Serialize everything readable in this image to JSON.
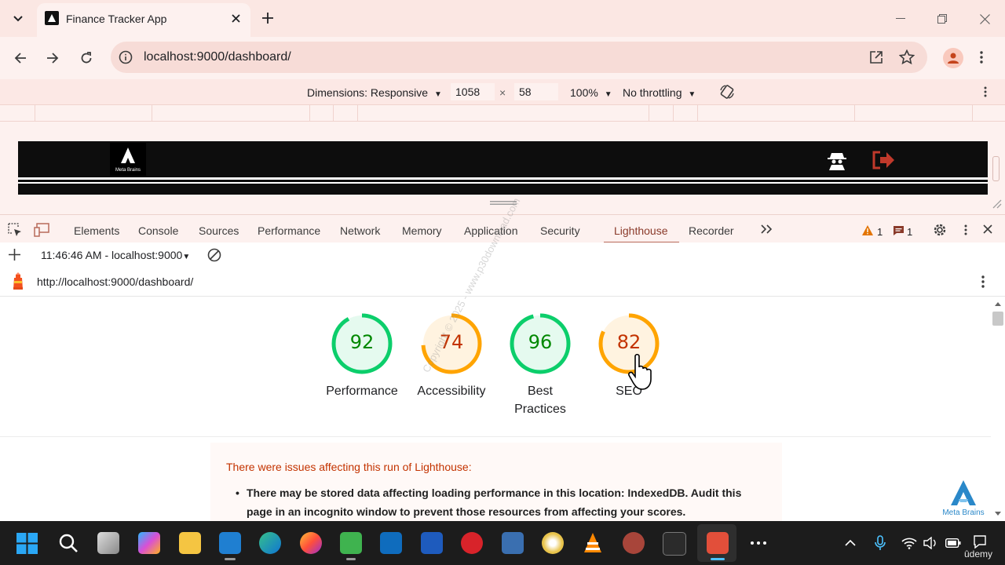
{
  "browser": {
    "tab": {
      "title": "Finance Tracker App"
    },
    "url": "localhost:9000/dashboard/"
  },
  "device_toolbar": {
    "dimensions_label": "Dimensions: Responsive",
    "width": "1058",
    "times": "×",
    "height": "58",
    "zoom": "100%",
    "throttling": "No throttling"
  },
  "site": {
    "logo_text": "Meta Brains"
  },
  "devtools": {
    "tabs": [
      "Elements",
      "Console",
      "Sources",
      "Performance",
      "Network",
      "Memory",
      "Application",
      "Security",
      "Lighthouse",
      "Recorder"
    ],
    "active_tab": "Lighthouse",
    "warnings_count": "1",
    "messages_count": "1"
  },
  "lighthouse": {
    "report_select": "11:46:46 AM - localhost:9000",
    "report_url": "http://localhost:9000/dashboard/",
    "scores": [
      {
        "label": "Performance",
        "value": 92,
        "color": "#0cce6b",
        "text_color": "#008800",
        "bg": "#e5faef"
      },
      {
        "label": "Accessibility",
        "value": 74,
        "color": "#ffa400",
        "text_color": "#c33300",
        "bg": "#fff3e0"
      },
      {
        "label": "Best Practices",
        "value": 96,
        "color": "#0cce6b",
        "text_color": "#008800",
        "bg": "#e5faef"
      },
      {
        "label": "SEO",
        "value": 82,
        "color": "#ffa400",
        "text_color": "#c33300",
        "bg": "#fff3e0"
      }
    ],
    "warning_title": "There were issues affecting this run of Lighthouse:",
    "warning_item": "There may be stored data affecting loading performance in this location: IndexedDB. Audit this page in an incognito window to prevent those resources from affecting your scores."
  },
  "watermark": {
    "brand": "Meta Brains",
    "udemy": "ûdemy",
    "copyright": "Copyright © 2025 - www.p30download.com"
  }
}
